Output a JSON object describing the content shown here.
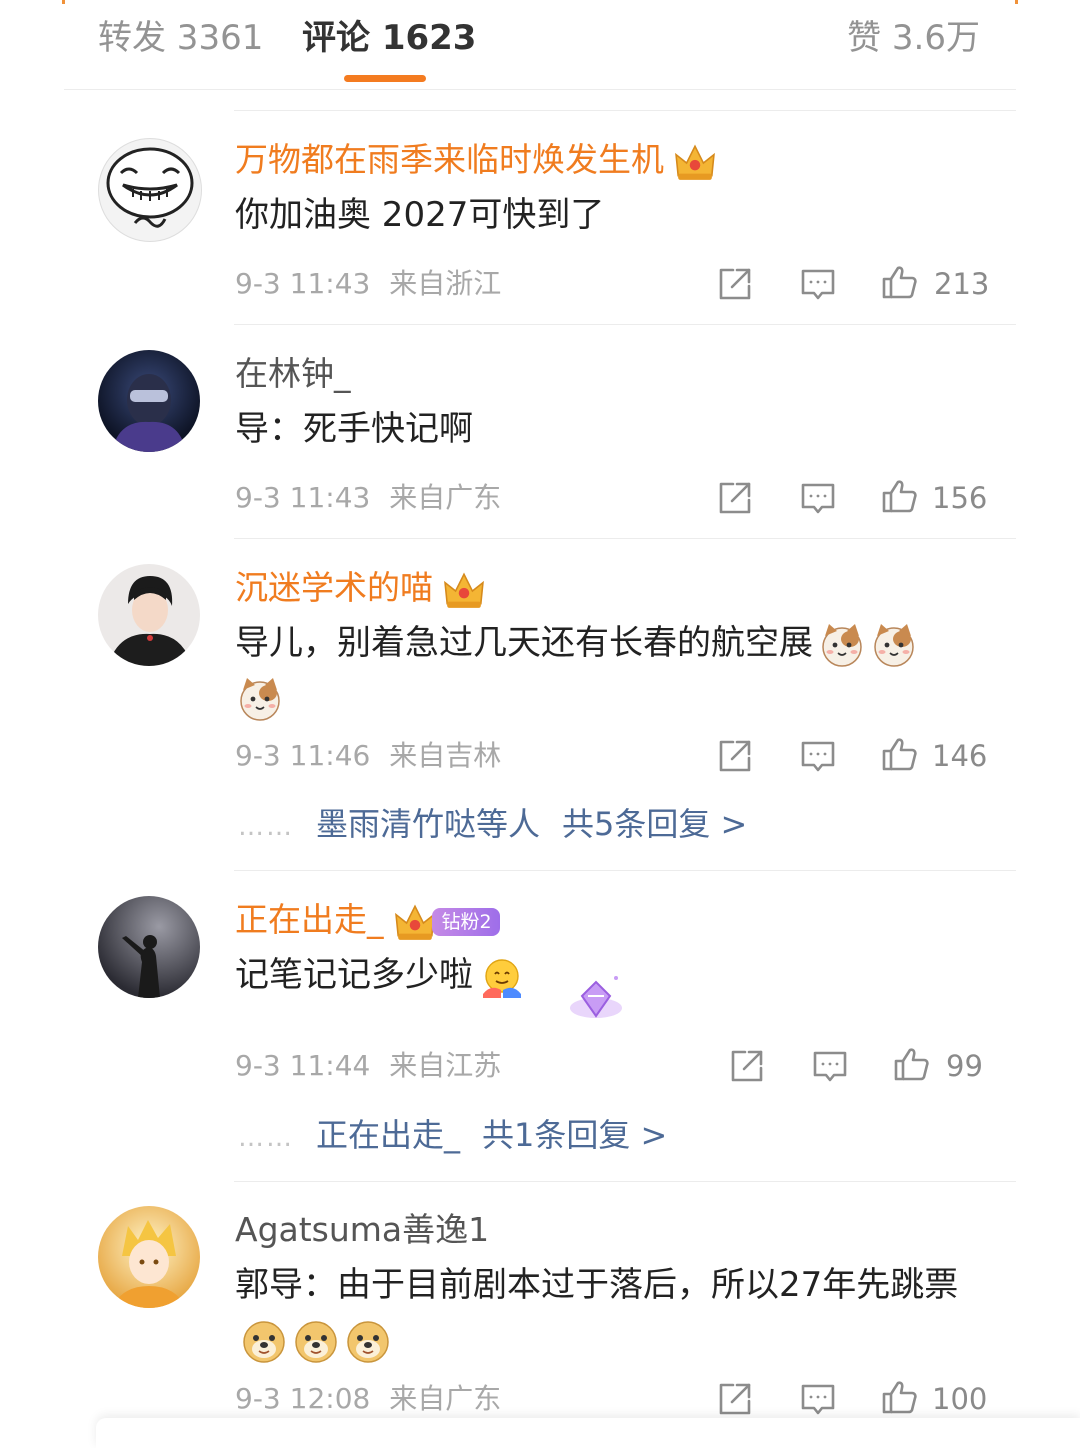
{
  "tabs": {
    "repost": "转发 3361",
    "comments": "评论 1623",
    "likes": "赞 3.6万"
  },
  "comments": [
    {
      "username": "万物都在雨季来临时焕发生机",
      "text": "你加油奥 2027可快到了",
      "time": "9-3 11:43",
      "location": "来自浙江",
      "likes": "213"
    },
    {
      "username": "在林钟_",
      "text": "导：死手快记啊",
      "time": "9-3 11:43",
      "location": "来自广东",
      "likes": "156"
    },
    {
      "username": "沉迷学术的喵",
      "text": "导儿，别着急过几天还有长春的航空展",
      "time": "9-3 11:46",
      "location": "来自吉林",
      "likes": "146",
      "reply_users": "墨雨清竹哒等人",
      "reply_count": "共5条回复 >"
    },
    {
      "username": "正在出走_",
      "fan_badge": "钻粉2",
      "text": "记笔记记多少啦",
      "time": "9-3 11:44",
      "location": "来自江苏",
      "likes": "99",
      "reply_users": "正在出走_",
      "reply_count": "共1条回复 >"
    },
    {
      "username": "Agatsuma善逸1",
      "text": "郭导：由于目前剧本过于落后，所以27年先跳票",
      "time": "9-3 12:08",
      "location": "来自广东",
      "likes": "100"
    }
  ],
  "reply_dots": "……",
  "colors": {
    "accent": "#f47b20",
    "vip_name": "#f07c1f",
    "reply_link": "#4d6a96"
  }
}
